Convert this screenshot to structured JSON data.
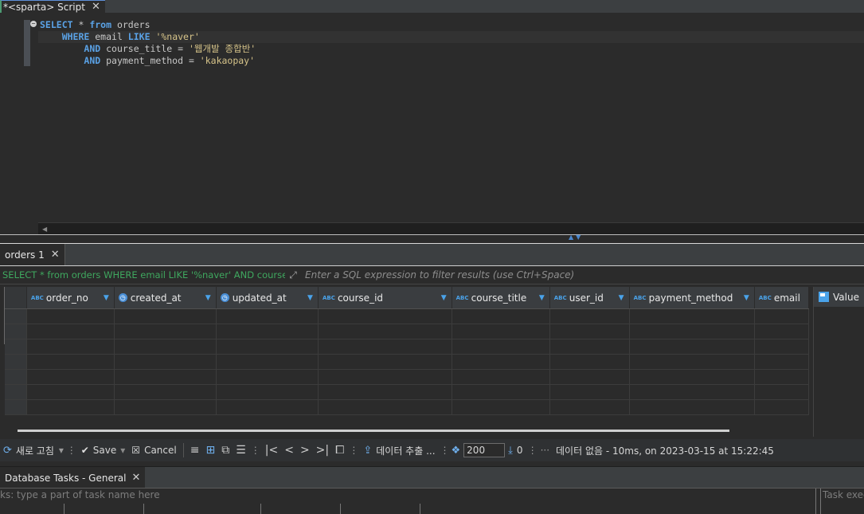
{
  "editor_tab": {
    "label": "*<sparta> Script"
  },
  "editor": {
    "lines": [
      [
        {
          "t": "kw",
          "v": "SELECT"
        },
        {
          "t": "id",
          "v": " * "
        },
        {
          "t": "kw",
          "v": "from"
        },
        {
          "t": "id",
          "v": " orders"
        }
      ],
      [
        {
          "t": "id",
          "v": "    "
        },
        {
          "t": "kw",
          "v": "WHERE"
        },
        {
          "t": "id",
          "v": " email "
        },
        {
          "t": "kw",
          "v": "LIKE"
        },
        {
          "t": "id",
          "v": " "
        },
        {
          "t": "str",
          "v": "'%naver'"
        }
      ],
      [
        {
          "t": "id",
          "v": "        "
        },
        {
          "t": "kw",
          "v": "AND"
        },
        {
          "t": "id",
          "v": " course_title = "
        },
        {
          "t": "str",
          "v": "'웹개발 종합반'"
        }
      ],
      [
        {
          "t": "id",
          "v": "        "
        },
        {
          "t": "kw",
          "v": "AND"
        },
        {
          "t": "id",
          "v": " payment_method = "
        },
        {
          "t": "str",
          "v": "'kakaopay'"
        }
      ]
    ]
  },
  "results_tab": {
    "label": "orders 1"
  },
  "filter": {
    "query": "SELECT * from orders WHERE email LIKE '%naver' AND course_ti",
    "placeholder": "Enter a SQL expression to filter results (use Ctrl+Space)"
  },
  "grid": {
    "columns": [
      {
        "name": "order_no",
        "type": "abc-key"
      },
      {
        "name": "created_at",
        "type": "datetime"
      },
      {
        "name": "updated_at",
        "type": "datetime"
      },
      {
        "name": "course_id",
        "type": "abc"
      },
      {
        "name": "course_title",
        "type": "abc"
      },
      {
        "name": "user_id",
        "type": "abc-key"
      },
      {
        "name": "payment_method",
        "type": "abc"
      },
      {
        "name": "email",
        "type": "abc"
      }
    ],
    "empty_rows": 7
  },
  "value_panel": {
    "label": "Value"
  },
  "toolbar": {
    "refresh_label": "새로 고침",
    "save_label": "Save",
    "cancel_label": "Cancel",
    "export_label": "데이터 추출 ...",
    "fetch_size": "200",
    "row_count": "0",
    "status": "데이터 없음 - 10ms, on 2023-03-15 at 15:22:45"
  },
  "tasks_tab": {
    "label": "Database Tasks - General"
  },
  "tasks_filter": {
    "placeholder": "ks: type a part of task name here",
    "right_placeholder": "Task exec"
  },
  "colors": {
    "keyword": "#5aa2e6",
    "string": "#d7c48a",
    "accent": "#4aa3ea",
    "filter_query": "#3fa85f"
  }
}
